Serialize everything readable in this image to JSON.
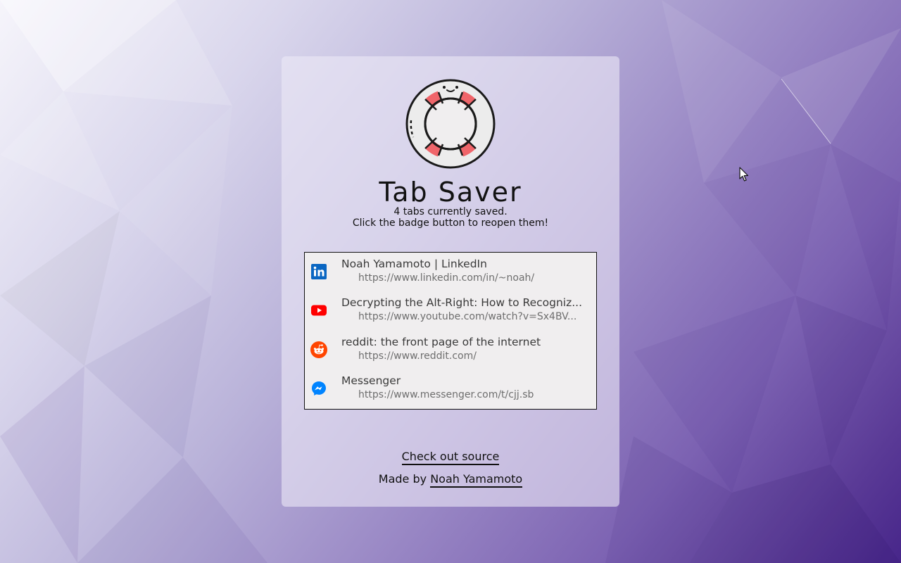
{
  "app": {
    "title": "Tab Saver",
    "status_line": "4 tabs currently saved.",
    "hint_line": "Click the badge button to reopen them!"
  },
  "tabs": [
    {
      "title": "Noah Yamamoto | LinkedIn",
      "url": "https://www.linkedin.com/in/~noah/",
      "icon": "linkedin-icon"
    },
    {
      "title": "Decrypting the Alt-Right: How to Recogniz...",
      "url": "https://www.youtube.com/watch?v=Sx4BV...",
      "icon": "youtube-icon"
    },
    {
      "title": "reddit: the front page of the internet",
      "url": "https://www.reddit.com/",
      "icon": "reddit-icon"
    },
    {
      "title": "Messenger",
      "url": "https://www.messenger.com/t/cjj.sb",
      "icon": "messenger-icon"
    }
  ],
  "footer": {
    "source_label": "Check out source",
    "made_by_prefix": "Made by",
    "author_name": "Noah Yamamoto"
  },
  "colors": {
    "background_start": "#f6f5fb",
    "background_end": "#47268a",
    "linkedin": "#0a66c2",
    "youtube": "#ff0000",
    "reddit": "#ff4500",
    "messenger": "#0084ff",
    "lifebuoy_red": "#f0656a"
  }
}
